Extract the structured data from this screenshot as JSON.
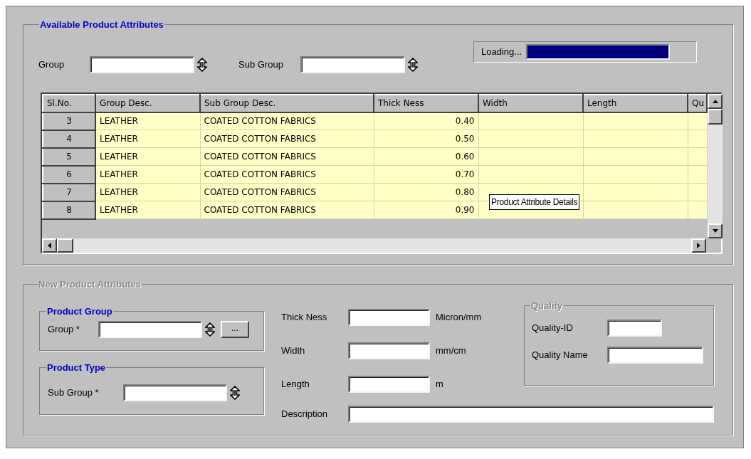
{
  "available": {
    "title": "Available Product Attributes",
    "disabled": false,
    "filters": [
      {
        "label": "Group"
      },
      {
        "label": "Sub Group"
      }
    ],
    "loading": {
      "label": "Loading...",
      "level": 1
    },
    "grid": {
      "columns": [
        "Sl.No.",
        "Group Desc.",
        "Sub Group Desc.",
        "Thick Ness",
        "Width",
        "Length",
        "Qu"
      ],
      "rows": [
        {
          "cells": [
            "3",
            "LEATHER",
            "COATED COTTON FABRICS",
            "0.40"
          ]
        },
        {
          "cells": [
            "4",
            "LEATHER",
            "COATED COTTON FABRICS",
            "0.50"
          ]
        },
        {
          "cells": [
            "5",
            "LEATHER",
            "COATED COTTON FABRICS",
            "0.60"
          ]
        },
        {
          "cells": [
            "6",
            "LEATHER",
            "COATED COTTON FABRICS",
            "0.70"
          ]
        },
        {
          "cells": [
            "7",
            "LEATHER",
            "COATED COTTON FABRICS",
            "0.80"
          ]
        },
        {
          "cells": [
            "8",
            "LEATHER",
            "COATED COTTON FABRICS",
            "0.90"
          ]
        }
      ],
      "tooltip": "Product Attribute Details"
    }
  },
  "new": {
    "title": "New Product Attributes",
    "disabled": true,
    "product_group": {
      "title": "Product Group",
      "disabled": false,
      "label": "Group *",
      "button": "..."
    },
    "product_type": {
      "title": "Product Type",
      "disabled": false,
      "label": "Sub Group *"
    },
    "measures": [
      {
        "label": "Thick Ness",
        "unit": "Micron/mm"
      },
      {
        "label": "Width",
        "unit": "mm/cm"
      },
      {
        "label": "Length",
        "unit": "m"
      }
    ],
    "quality": {
      "title": "Quality",
      "disabled": true,
      "fields": [
        {
          "label": "Quality-ID"
        },
        {
          "label": "Quality Name"
        }
      ]
    },
    "description": {
      "label": "Description"
    }
  }
}
